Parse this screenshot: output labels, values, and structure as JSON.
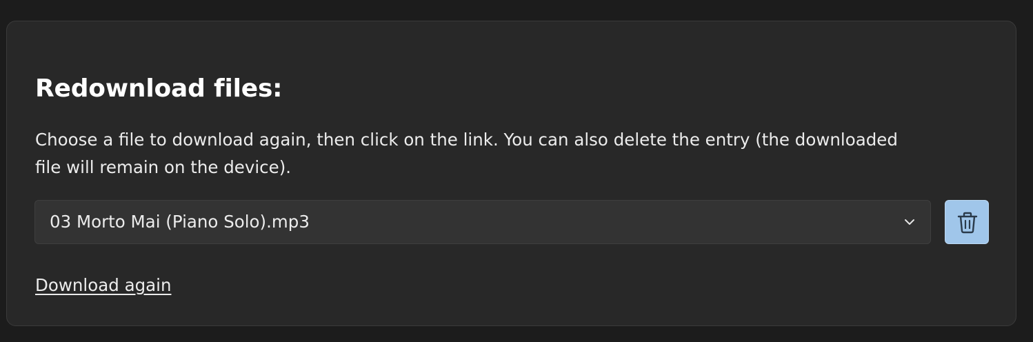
{
  "panel": {
    "title": "Redownload files:",
    "description": "Choose a file to download again, then click on the link. You can also delete the entry (the downloaded file will remain on the device).",
    "file_select": {
      "selected_value": "03 Morto Mai (Piano Solo).mp3",
      "icon": "chevron-down-icon"
    },
    "delete_button": {
      "icon": "trash-icon",
      "color": "#a0c6ea"
    },
    "download_link": "Download again"
  },
  "colors": {
    "page_background": "#1c1c1c",
    "panel_background": "#282828",
    "text": "#ececec",
    "accent": "#a0c6ea"
  }
}
